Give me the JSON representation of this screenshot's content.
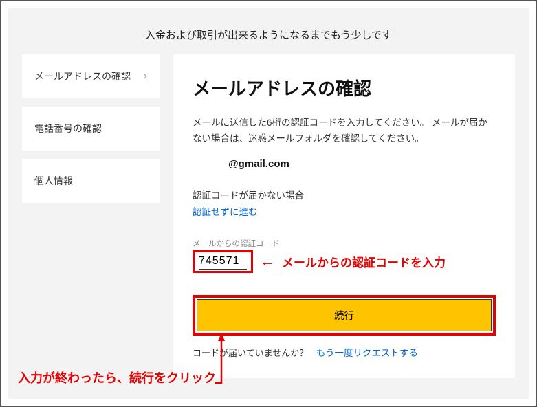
{
  "banner": "入金および取引が出来るようになるまでもう少しです",
  "sidebar": {
    "items": [
      {
        "label": "メールアドレスの確認",
        "active": true
      },
      {
        "label": "電話番号の確認",
        "active": false
      },
      {
        "label": "個人情報",
        "active": false
      }
    ]
  },
  "main": {
    "title": "メールアドレスの確認",
    "description": "メールに送信した6桁の認証コードを入力してください。 メールが届かない場合は、迷惑メールフォルダを確認してください。",
    "email": "@gmail.com",
    "no_code_label": "認証コードが届かない場合",
    "no_code_link": "認証せずに進む",
    "field_label": "メールからの認証コード",
    "field_value": "745571",
    "continue_label": "続行",
    "resend_q": "コードが届いていませんか？",
    "resend_link": "もう一度リクエストする"
  },
  "annotations": {
    "input_hint": "メールからの認証コードを入力",
    "continue_hint": "入力が終わったら、続行をクリック"
  }
}
